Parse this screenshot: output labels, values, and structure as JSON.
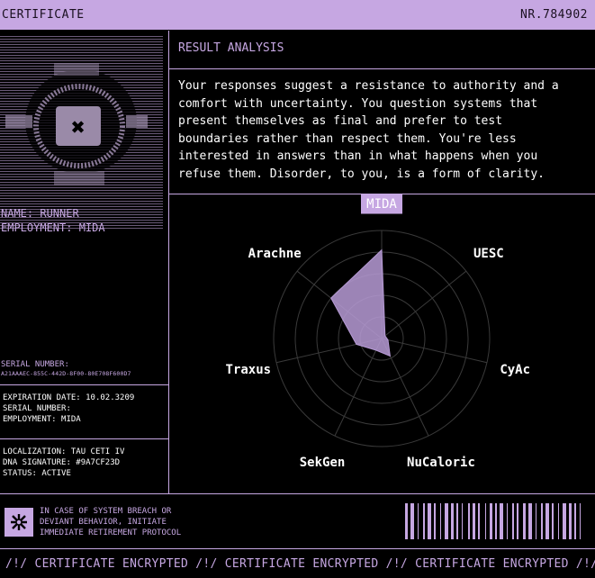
{
  "header": {
    "title": "CERTIFICATE",
    "number": "NR.784902"
  },
  "profile": {
    "name_line": "NAME: RUNNER",
    "employment_line": "EMPLOYMENT: MIDA",
    "serial_label": "SERIAL NUMBER:",
    "serial_value": "A21AAAEC-855C-442D-8F00-80E708F600D7"
  },
  "details": {
    "expiration": "EXPIRATION DATE: 10.02.3209",
    "serial": "SERIAL NUMBER:",
    "employment": "EMPLOYMENT: MIDA",
    "localization": "LOCALIZATION: TAU CETI IV",
    "dna": "DNA SIGNATURE: #9A7CF23D",
    "status": "STATUS: ACTIVE"
  },
  "analysis": {
    "heading": "RESULT ANALYSIS",
    "text": "Your responses suggest a resistance to authority and a comfort with uncertainty. You question systems that present themselves as final and prefer to test boundaries rather than respect them. You're less interested in answers than in what happens when you refuse them. Disorder, to you, is a form of clarity."
  },
  "chart_data": {
    "type": "radar",
    "categories": [
      "MIDA",
      "UESC",
      "CyAc",
      "NuCaloric",
      "SekGen",
      "Traxus",
      "Arachne"
    ],
    "highlighted": "MIDA",
    "rmax": 5,
    "rings": 5,
    "values": [
      4.1,
      0.2,
      0.3,
      0.9,
      0.6,
      1.2,
      3.0
    ],
    "fill_color": "#b79bd6"
  },
  "footer": {
    "warning_lines": [
      "IN CASE OF SYSTEM BREACH OR",
      "DEVIANT BEHAVIOR, INITIATE",
      "IMMEDIATE RETIREMENT PROTOCOL"
    ],
    "ticker_text": "/!/ CERTIFICATE ENCRYPTED /!/ CERTIFICATE ENCRYPTED /!/ CERTIFICATE ENCRYPTED /!/ CE"
  },
  "colors": {
    "accent": "#c6a7e2",
    "background": "#000000",
    "text": "#ffffff"
  },
  "icons": {
    "warning": "glyph-icon",
    "portrait": "ascii-portrait"
  }
}
